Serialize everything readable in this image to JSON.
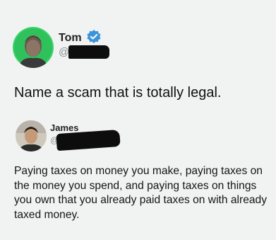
{
  "tweet": {
    "author_name": "Tom",
    "author_handle_prefix": "@",
    "verified": true,
    "text": "Name a scam that is totally legal.",
    "avatar": "avatar-photo-man-green-background"
  },
  "reply": {
    "author_name": "James",
    "author_handle_prefix": "@",
    "text": "Paying taxes on money you make, paying taxes on the money you spend, and paying taxes on things you own that you already paid taxes on with already taxed money.",
    "avatar": "avatar-photo-man-indoor"
  },
  "colors": {
    "verified_badge": "#3b94d9",
    "background": "#f1f2f2",
    "avatar_bg": "#3bd36a"
  }
}
